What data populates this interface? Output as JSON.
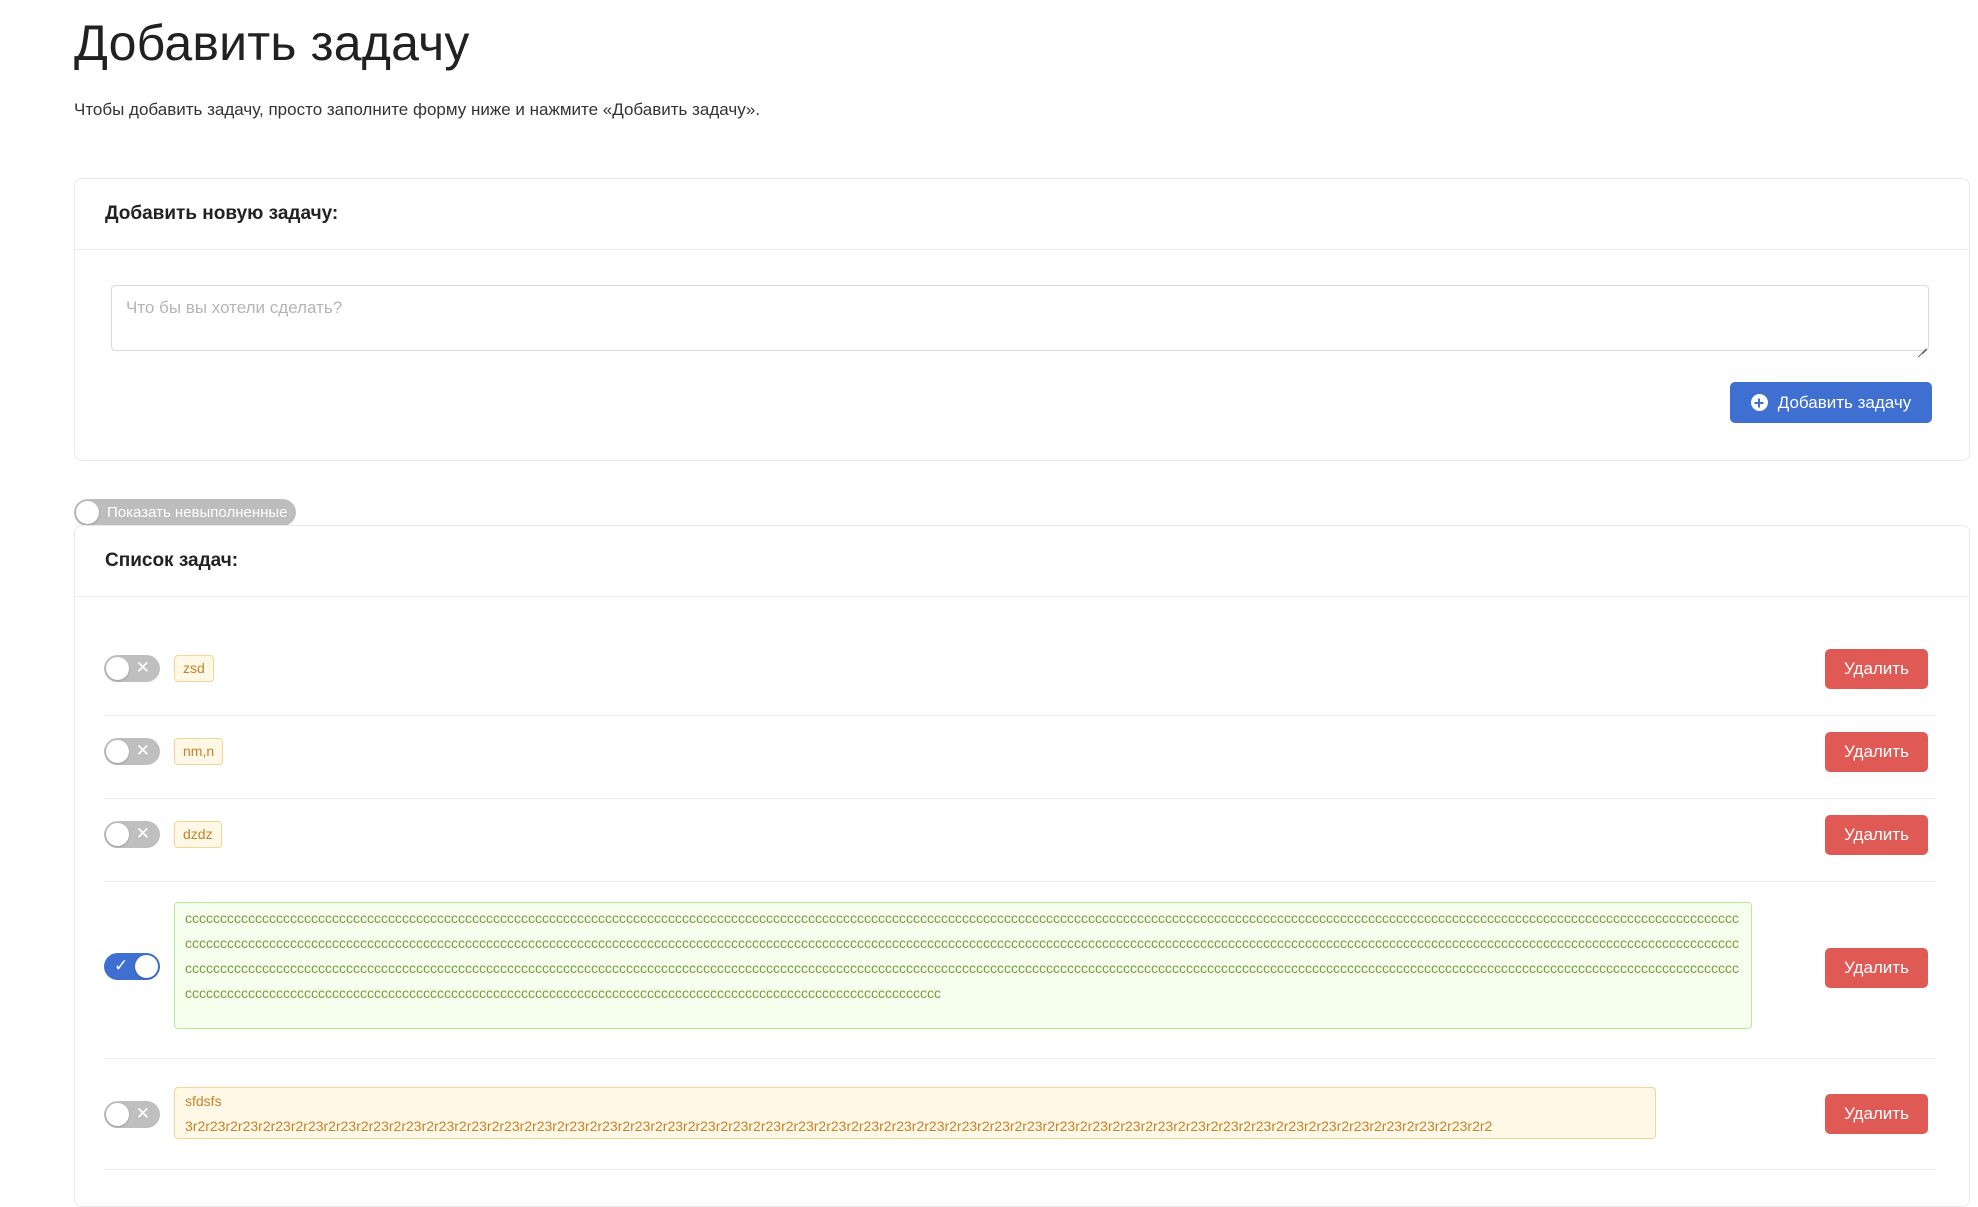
{
  "page": {
    "title": "Добавить задачу",
    "intro": "Чтобы добавить задачу, просто заполните форму ниже и нажмите «Добавить задачу»."
  },
  "add_form": {
    "header": "Добавить новую задачу:",
    "placeholder": "Что бы вы хотели сделать?",
    "value": "",
    "submit_label": "Добавить задачу",
    "submit_icon": "plus-circle-icon"
  },
  "filter": {
    "label": "Показать невыполненные",
    "enabled": false
  },
  "list": {
    "header": "Список задач:",
    "delete_label": "Удалить",
    "tasks": [
      {
        "text": "zsd",
        "done": false,
        "toggle_glyph": "✕"
      },
      {
        "text": "nm,n",
        "done": false,
        "toggle_glyph": "✕"
      },
      {
        "text": "dzdz",
        "done": false,
        "toggle_glyph": "✕"
      },
      {
        "text": "cccccccccccccccccccccccccccccccccccccccccccccccccccccccccccccccccccccccccccccccccccccccccccccccccccccccccccccccccccccccccccccccccccccccccccccccccccccccccccccccccccccccccccccccccccccccccccccccccccccccccccccccccccccccccccccccccccccccccccccccccccccccccccccccccccccccccccccccccccccccccccccccccccccccccccccccccccccccccccccccccccccccccccccccccccccccccccccccccccccccccccccccccccccccccccccccccccccccccccccccccccccccccccccccccccccccccccccccccccccccccccccccccccccccccccccccccccccccccccccccccccccccccccccccccccccccccccccccccccccccccccccccccccccccccccccccccccccccccccccccccccccccccccccccccccccccccccccccccccccccccccccccccccccccccccccccccccccccccccccccccccccccccccccccccccccccccccccccccccccccccccccccccccccccccccccccccccccccccccccccccccccccccccccccccccccccccccccccccccccccccccccccccccccc",
        "done": true,
        "toggle_glyph": "✓"
      },
      {
        "text": "sfdsfs\n3r2r23r2r23r2r23r2r23r2r23r2r23r2r23r2r23r2r23r2r23r2r23r2r23r2r23r2r23r2r23r2r23r2r23r2r23r2r23r2r23r2r23r2r23r2r23r2r23r2r23r2r23r2r23r2r23r2r23r2r23r2r23r2r23r2r23r2r23r2r23r2r23r2r23r2r23r2r23r2r2",
        "done": false,
        "toggle_glyph": "✕"
      }
    ]
  },
  "colors": {
    "accent": "#3f6fd1",
    "danger": "#e05a55",
    "pending_tag_bg": "#fff8e6",
    "done_tag_bg": "#f6ffed"
  }
}
